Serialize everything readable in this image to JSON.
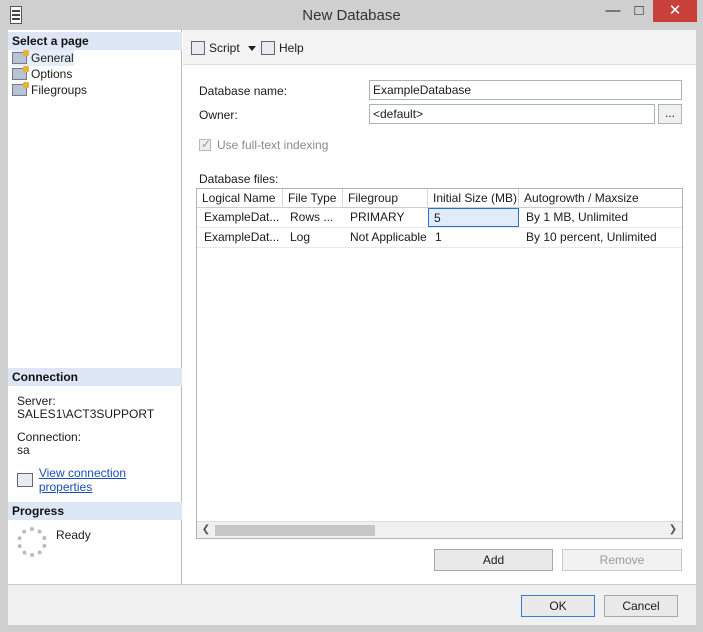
{
  "window": {
    "title": "New Database"
  },
  "left_panel": {
    "select_page_header": "Select a page",
    "pages": [
      {
        "label": "General"
      },
      {
        "label": "Options"
      },
      {
        "label": "Filegroups"
      }
    ],
    "connection_header": "Connection",
    "server_label": "Server:",
    "server_value": "SALES1\\ACT3SUPPORT",
    "connection_label": "Connection:",
    "connection_value": "sa",
    "view_connection_link": "View connection properties",
    "progress_header": "Progress",
    "progress_status": "Ready"
  },
  "toolbar": {
    "script_label": "Script",
    "help_label": "Help"
  },
  "general": {
    "database_name_label": "Database name:",
    "database_name_value": "ExampleDatabase",
    "owner_label": "Owner:",
    "owner_value": "<default>",
    "owner_browse_label": "...",
    "fulltext_label": "Use full-text indexing",
    "database_files_label": "Database files:"
  },
  "grid": {
    "columns": [
      "Logical Name",
      "File Type",
      "Filegroup",
      "Initial Size (MB)",
      "Autogrowth / Maxsize"
    ],
    "rows": [
      [
        "ExampleDat...",
        "Rows ...",
        "PRIMARY",
        "5",
        "By 1 MB, Unlimited"
      ],
      [
        "ExampleDat...",
        "Log",
        "Not Applicable",
        "1",
        "By 10 percent, Unlimited"
      ]
    ]
  },
  "buttons": {
    "add": "Add",
    "remove": "Remove",
    "ok": "OK",
    "cancel": "Cancel"
  }
}
